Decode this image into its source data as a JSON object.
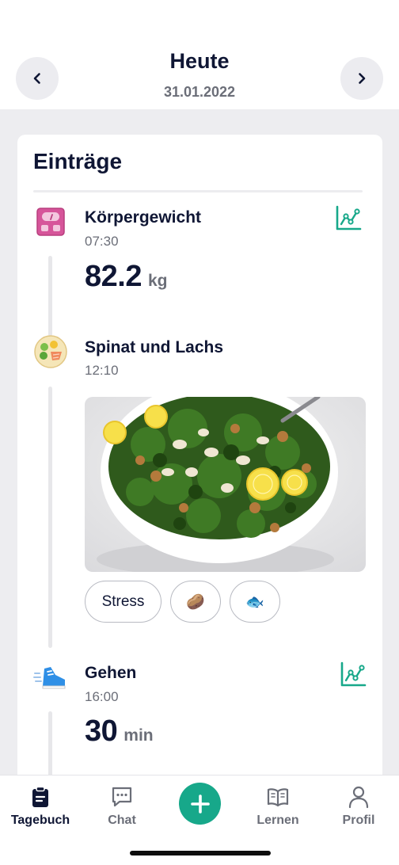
{
  "header": {
    "title": "Heute",
    "date": "31.01.2022",
    "prev_icon": "chevron-left-icon",
    "next_icon": "chevron-right-icon"
  },
  "entries_card": {
    "title": "Einträge",
    "entries": [
      {
        "icon": "scale-icon",
        "title": "Körpergewicht",
        "time": "07:30",
        "value": "82.2",
        "unit": "kg",
        "action_icon": "chart-icon"
      },
      {
        "icon": "meal-plate-icon",
        "title": "Spinat und Lachs",
        "time": "12:10",
        "photo": "kale-salad-photo",
        "tags": [
          {
            "label": "Stress"
          },
          {
            "label": "🥔",
            "icon": "potato-icon"
          },
          {
            "label": "🐟",
            "icon": "fish-icon"
          }
        ]
      },
      {
        "icon": "sneaker-icon",
        "title": "Gehen",
        "time": "16:00",
        "value": "30",
        "unit": "min",
        "action_icon": "chart-icon"
      }
    ]
  },
  "bottom_nav": {
    "items": [
      {
        "label": "Tagebuch",
        "icon": "clipboard-icon",
        "active": true
      },
      {
        "label": "Chat",
        "icon": "chat-bubble-icon",
        "active": false
      },
      {
        "label": "Lernen",
        "icon": "open-book-icon",
        "active": false
      },
      {
        "label": "Profil",
        "icon": "person-icon",
        "active": false
      }
    ],
    "add_icon": "plus-icon"
  },
  "colors": {
    "accent": "#17a88a",
    "navy": "#0f1634",
    "muted": "#6b6e78",
    "background": "#ededf0"
  }
}
